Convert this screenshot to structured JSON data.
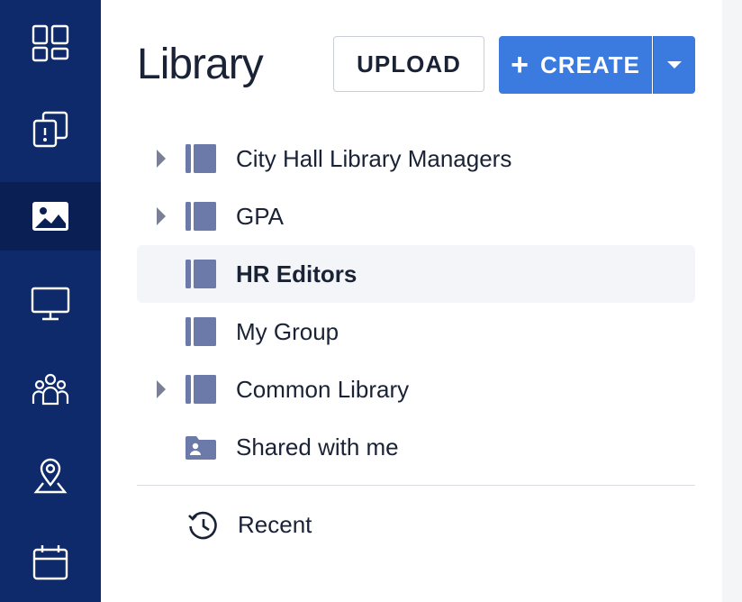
{
  "sidebar": {
    "items": [
      {
        "name": "dashboard",
        "icon": "dashboard-icon",
        "active": false
      },
      {
        "name": "alerts",
        "icon": "alert-cards-icon",
        "active": false
      },
      {
        "name": "library",
        "icon": "image-icon",
        "active": true
      },
      {
        "name": "screens",
        "icon": "monitor-icon",
        "active": false
      },
      {
        "name": "groups",
        "icon": "users-icon",
        "active": false
      },
      {
        "name": "locations",
        "icon": "location-pin-icon",
        "active": false
      },
      {
        "name": "schedule",
        "icon": "calendar-icon",
        "active": false
      }
    ],
    "background": "#0e2a6b",
    "active_background": "#0a1f54"
  },
  "header": {
    "title": "Library",
    "upload_label": "UPLOAD",
    "create_label": "CREATE",
    "create_plus": "+",
    "accent_color": "#3b7be0"
  },
  "tree": {
    "items": [
      {
        "label": "City Hall Library Managers",
        "icon": "book-icon",
        "expandable": true,
        "selected": false
      },
      {
        "label": "GPA",
        "icon": "book-icon",
        "expandable": true,
        "selected": false
      },
      {
        "label": "HR Editors",
        "icon": "book-icon",
        "expandable": false,
        "selected": true
      },
      {
        "label": "My Group",
        "icon": "book-icon",
        "expandable": false,
        "selected": false
      },
      {
        "label": "Common Library",
        "icon": "book-icon",
        "expandable": true,
        "selected": false
      },
      {
        "label": "Shared with me",
        "icon": "shared-folder-icon",
        "expandable": false,
        "selected": false
      }
    ],
    "recent_label": "Recent"
  }
}
